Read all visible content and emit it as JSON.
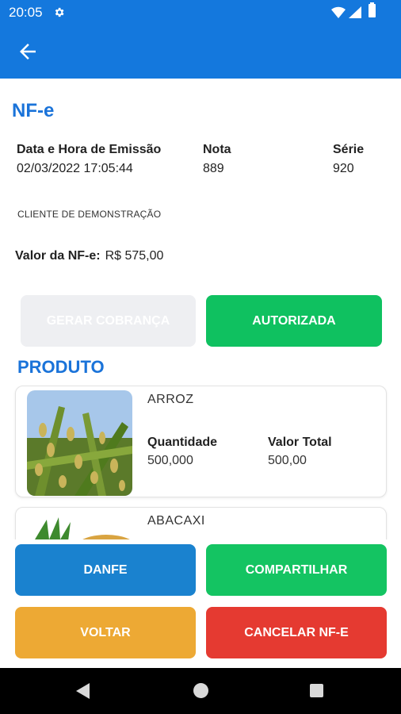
{
  "status_bar": {
    "time": "20:05"
  },
  "header": {
    "title": "NF-e"
  },
  "nota": {
    "emissao_label": "Data e Hora de Emissão",
    "emissao_value": "02/03/2022 17:05:44",
    "nota_label": "Nota",
    "nota_value": "889",
    "serie_label": "Série",
    "serie_value": "920",
    "cliente": "CLIENTE DE DEMONSTRAÇÃO",
    "valor_label": "Valor da NF-e:",
    "valor_value": "R$ 575,00"
  },
  "actions": {
    "gerar_label": "GERAR COBRANÇA",
    "status_label": "AUTORIZADA"
  },
  "produtos": {
    "section_title": "PRODUTO",
    "items": [
      {
        "name": "ARROZ",
        "quantidade_label": "Quantidade",
        "quantidade": "500,000",
        "valor_label": "Valor Total",
        "valor": "500,00"
      },
      {
        "name": "ABACAXI"
      }
    ]
  },
  "bottom_buttons": {
    "danfe": "DANFE",
    "compartilhar": "COMPARTILHAR",
    "voltar": "VOLTAR",
    "cancelar": "CANCELAR NF-E"
  },
  "colors": {
    "app_bar": "#1478dd",
    "title_blue": "#1a73d9",
    "green": "#0fc160",
    "blue_button": "#1a82cf",
    "orange": "#eda934",
    "red": "#e53a31"
  },
  "icons": [
    "settings-gear-icon",
    "wifi-icon",
    "signal-icon",
    "battery-icon",
    "back-arrow-icon",
    "nav-back-icon",
    "nav-home-icon",
    "nav-recents-icon"
  ]
}
